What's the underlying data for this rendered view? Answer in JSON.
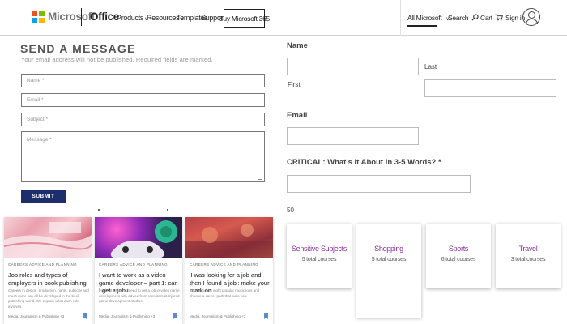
{
  "header": {
    "brand": "Microsoft",
    "product": "Office",
    "nav": [
      {
        "label": "Products",
        "has_chevron": true
      },
      {
        "label": "Resources",
        "has_chevron": true
      },
      {
        "label": "Templates",
        "has_chevron": false
      },
      {
        "label": "Support",
        "has_chevron": false
      }
    ],
    "buy_button": "Buy Microsoft 365",
    "all_microsoft": "All Microsoft",
    "search_label": "Search",
    "cart_label": "Cart",
    "signin_label": "Sign in",
    "icons": [
      "microsoft-logo-icon",
      "chevron-down-icon",
      "search-icon",
      "cart-icon",
      "user-avatar-icon"
    ],
    "logo_colors": [
      "#f25022",
      "#7fba00",
      "#00a4ef",
      "#ffb900"
    ]
  },
  "contact_form": {
    "title": "SEND A MESSAGE",
    "subtitle": "Your email address will not be published. Required fields are marked.",
    "name_placeholder": "Name *",
    "email_placeholder": "Email *",
    "subject_placeholder": "Subject *",
    "message_placeholder": "Message *",
    "submit_label": "SUBMIT",
    "submit_color": "#1c2e6b"
  },
  "articles": [
    {
      "category": "CAREERS ADVICE AND PLANNING",
      "title": "Job roles and types of employers in book publishing",
      "excerpt": "Careers in design, production, rights, publicity and much more can all be developed in the book publishing world. We explain what each role involves.",
      "footer": "Media, Journalism & Publishing +3"
    },
    {
      "category": "CAREERS ADVICE AND PLANNING",
      "title": "I want to work as a video game developer – part 1: can I get a job i...",
      "excerpt": "Find out what you need to get a job in video game development with advice from recruiters at Injured game development studios.",
      "footer": "Media, Journalism & Publishing +3"
    },
    {
      "category": "CAREERS ADVICE AND PLANNING",
      "title": "'I was looking for a job and then I found a job': make your mark on...",
      "excerpt": "Take a look at eight popular music jobs and choose a career path that suits you.",
      "footer": "Media, Journalism & Publishing +3"
    }
  ],
  "right_form": {
    "name_label": "Name",
    "first_label": "First",
    "last_label": "Last",
    "email_label": "Email",
    "critical_label": "CRITICAL: What's It About in 3-5 Words? *",
    "counter": "50"
  },
  "topics": [
    {
      "title": "Sensitive Subjects",
      "count": "5 total courses"
    },
    {
      "title": "Shopping",
      "count": "5 total courses"
    },
    {
      "title": "Sports",
      "count": "6 total courses"
    },
    {
      "title": "Travel",
      "count": "3 total courses"
    }
  ],
  "colors": {
    "topic_title": "#8a2f9e",
    "bookmark": "#5b8ad8"
  }
}
